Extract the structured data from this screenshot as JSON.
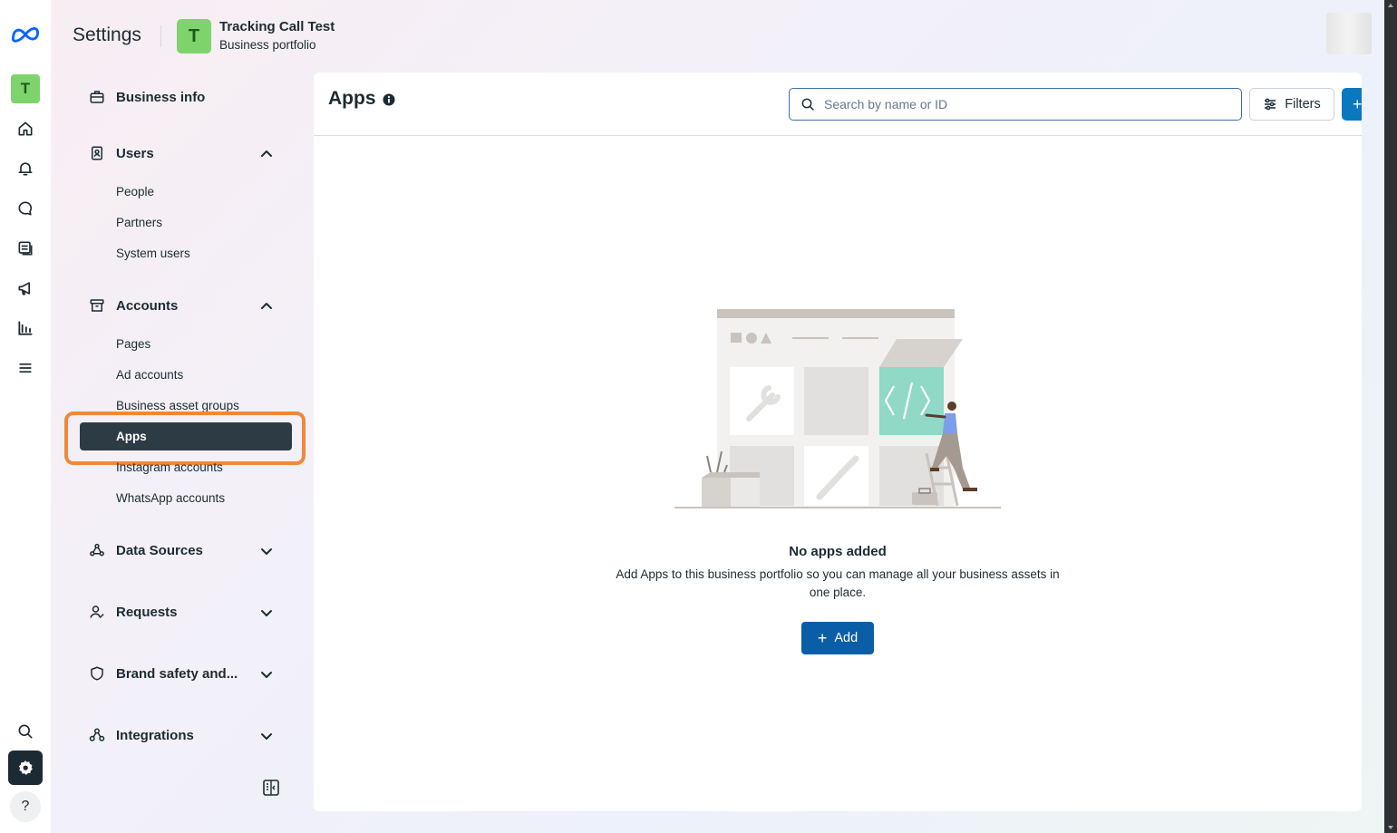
{
  "header": {
    "title": "Settings",
    "portfolio_initial": "T",
    "portfolio_name": "Tracking Call Test",
    "portfolio_type": "Business portfolio"
  },
  "rail": {
    "avatar_initial": "T",
    "icons": [
      "meta-logo-icon",
      "home-icon",
      "bell-icon",
      "chat-icon",
      "pages-icon",
      "megaphone-icon",
      "insights-icon",
      "menu-icon",
      "search-icon",
      "gear-icon",
      "help-icon"
    ],
    "help_glyph": "?"
  },
  "sidebar": {
    "business_info": "Business info",
    "users": {
      "label": "Users",
      "items": [
        "People",
        "Partners",
        "System users"
      ]
    },
    "accounts": {
      "label": "Accounts",
      "items": [
        "Pages",
        "Ad accounts",
        "Business asset groups",
        "Apps",
        "Instagram accounts",
        "WhatsApp accounts"
      ],
      "active": "Apps"
    },
    "data_sources": "Data Sources",
    "requests": "Requests",
    "brand_safety": "Brand safety and...",
    "integrations": "Integrations"
  },
  "main": {
    "title": "Apps",
    "search_placeholder": "Search by name or ID",
    "filters_label": "Filters",
    "plus_glyph": "+",
    "empty_title": "No apps added",
    "empty_description": "Add Apps to this business portfolio so you can manage all your business assets in one place.",
    "add_label": "Add",
    "add_glyph": "+"
  },
  "colors": {
    "primary_blue": "#0a5ea8",
    "active_nav_bg": "#2d3b45",
    "highlight_orange": "#f0883a",
    "avatar_green": "#7ed36d",
    "illustration_teal": "#8fd9c6"
  }
}
